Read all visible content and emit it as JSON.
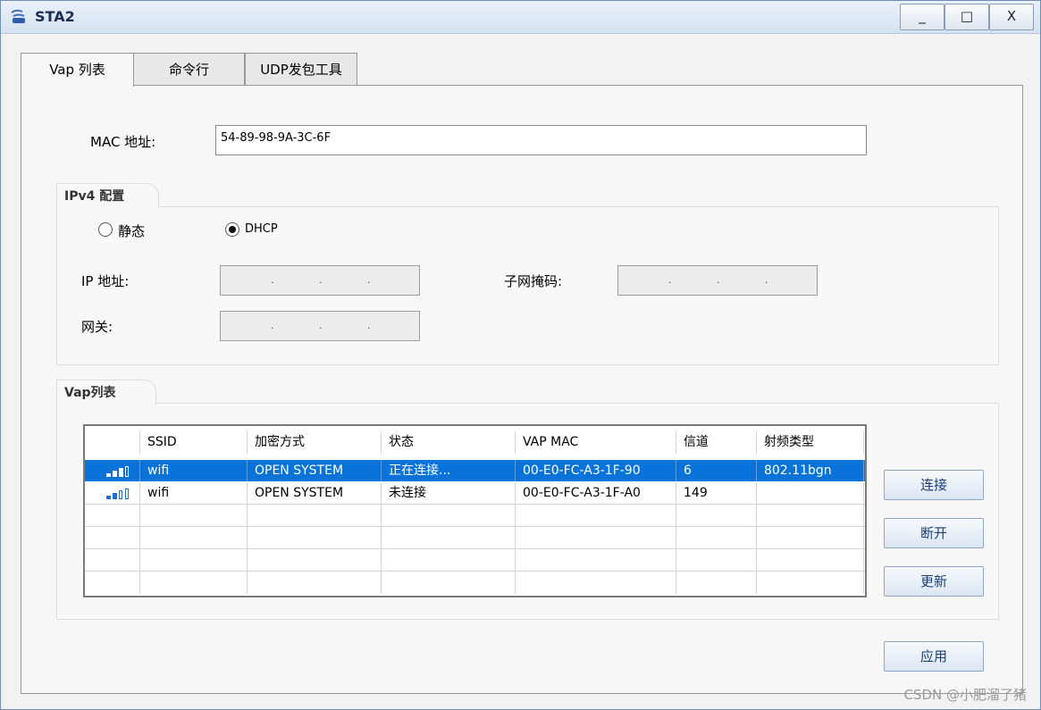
{
  "window": {
    "title": "STA2",
    "minimize_label": "_",
    "maximize_label": "□",
    "close_label": "X"
  },
  "tabs": [
    {
      "label": "Vap 列表",
      "active": true
    },
    {
      "label": "命令行",
      "active": false
    },
    {
      "label": "UDP发包工具",
      "active": false
    }
  ],
  "mac": {
    "label": "MAC 地址:",
    "value": "54-89-98-9A-3C-6F"
  },
  "ipv4": {
    "group_title": "IPv4 配置",
    "static_label": "静态",
    "dhcp_label": "DHCP",
    "selected": "DHCP",
    "ip_label": "IP 地址:",
    "mask_label": "子网掩码:",
    "gateway_label": "网关:",
    "ip_value": "",
    "mask_value": "",
    "gateway_value": ""
  },
  "vap": {
    "group_title": "Vap列表",
    "columns": [
      "SSID",
      "加密方式",
      "状态",
      "VAP MAC",
      "信道",
      "射频类型"
    ],
    "rows": [
      {
        "signal": 3,
        "ssid": "wifi",
        "encryption": "OPEN SYSTEM",
        "status": "正在连接...",
        "vap_mac": "00-E0-FC-A3-1F-90",
        "channel": "6",
        "radio": "802.11bgn",
        "selected": true
      },
      {
        "signal": 2,
        "ssid": "wifi",
        "encryption": "OPEN SYSTEM",
        "status": "未连接",
        "vap_mac": "00-E0-FC-A3-1F-A0",
        "channel": "149",
        "radio": "",
        "selected": false
      }
    ],
    "connect_label": "连接",
    "disconnect_label": "断开",
    "refresh_label": "更新"
  },
  "apply_label": "应用",
  "watermark": "CSDN @小肥溜了猪",
  "colors": {
    "selection": "#0a73d9",
    "signal": "#1a6fd0",
    "title_text": "#1b2f55"
  }
}
